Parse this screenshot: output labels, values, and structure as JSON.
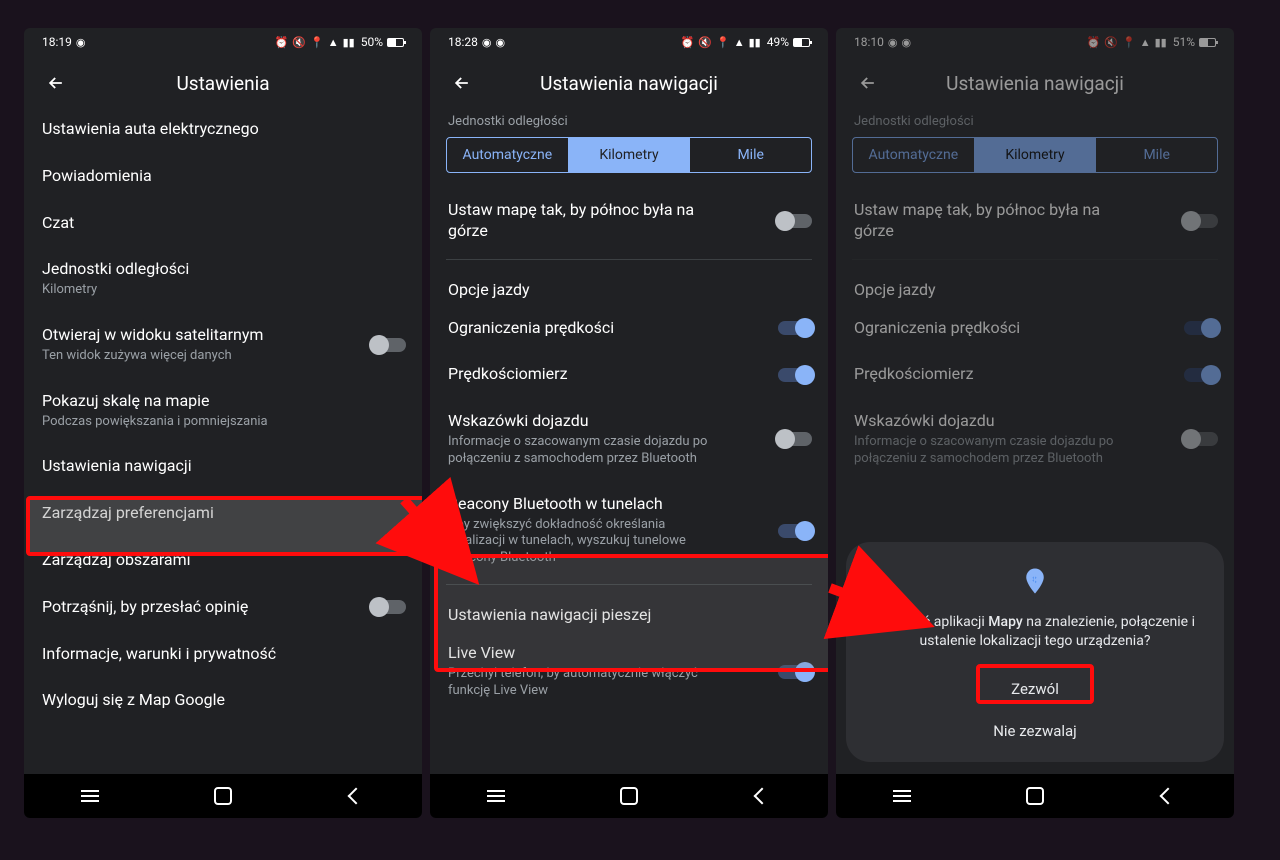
{
  "screen1": {
    "status": {
      "time": "18:19",
      "battery": "50%"
    },
    "title": "Ustawienia",
    "items": [
      {
        "title": "Ustawienia auta elektrycznego"
      },
      {
        "title": "Powiadomienia"
      },
      {
        "title": "Czat"
      },
      {
        "title": "Jednostki odległości",
        "sub": "Kilometry"
      },
      {
        "title": "Otwieraj w widoku satelitarnym",
        "sub": "Ten widok zużywa więcej danych",
        "toggle": false
      },
      {
        "title": "Pokazuj skalę na mapie",
        "sub": "Podczas powiększania i pomniejszania"
      },
      {
        "title": "Ustawienia nawigacji",
        "highlight": true
      },
      {
        "title": "Zarządzaj preferencjami"
      },
      {
        "title": "Zarządzaj obszarami"
      },
      {
        "title": "Potrząśnij, by przesłać opinię",
        "toggle": false
      },
      {
        "title": "Informacje, warunki i prywatność"
      },
      {
        "title": "Wyloguj się z Map Google"
      }
    ]
  },
  "screen2": {
    "status": {
      "time": "18:28",
      "battery": "49%"
    },
    "title": "Ustawienia nawigacji",
    "units_label": "Jednostki odległości",
    "units": [
      "Automatyczne",
      "Kilometry",
      "Mile"
    ],
    "units_selected": 1,
    "north": {
      "title": "Ustaw mapę tak, by północ była na górze",
      "toggle": false
    },
    "drive_header": "Opcje jazdy",
    "drive": [
      {
        "title": "Ograniczenia prędkości",
        "toggle": true
      },
      {
        "title": "Prędkościomierz",
        "toggle": true
      },
      {
        "title": "Wskazówki dojazdu",
        "sub": "Informacje o szacowanym czasie dojazdu po połączeniu z samochodem przez Bluetooth",
        "toggle": false
      },
      {
        "title": "Beacony Bluetooth w tunelach",
        "sub": "Aby zwiększyć dokładność określania lokalizacji w tunelach, wyszukuj tunelowe beacony Bluetooth",
        "toggle": true,
        "highlight": true
      }
    ],
    "walk_header": "Ustawienia nawigacji pieszej",
    "walk": [
      {
        "title": "Live View",
        "sub": "Przechyl telefon, by automatycznie włączyć funkcję Live View",
        "toggle": true
      }
    ]
  },
  "screen3": {
    "status": {
      "time": "18:10",
      "battery": "51%"
    },
    "title": "Ustawienia nawigacji",
    "units_label": "Jednostki odległości",
    "units": [
      "Automatyczne",
      "Kilometry",
      "Mile"
    ],
    "units_selected": 1,
    "north": {
      "title": "Ustaw mapę tak, by północ była na górze",
      "toggle": false
    },
    "drive_header": "Opcje jazdy",
    "drive": [
      {
        "title": "Ograniczenia prędkości",
        "toggle": true
      },
      {
        "title": "Prędkościomierz",
        "toggle": true
      },
      {
        "title": "Wskazówki dojazdu",
        "sub": "Informacje o szacowanym czasie dojazdu po połączeniu z samochodem przez Bluetooth",
        "toggle": false
      }
    ],
    "dialog": {
      "text_prefix": "Zezwolić aplikacji ",
      "app": "Mapy",
      "text_suffix": " na znalezienie, połączenie i ustalenie lokalizacji tego urządzenia?",
      "allow": "Zezwól",
      "deny": "Nie zezwalaj"
    }
  }
}
